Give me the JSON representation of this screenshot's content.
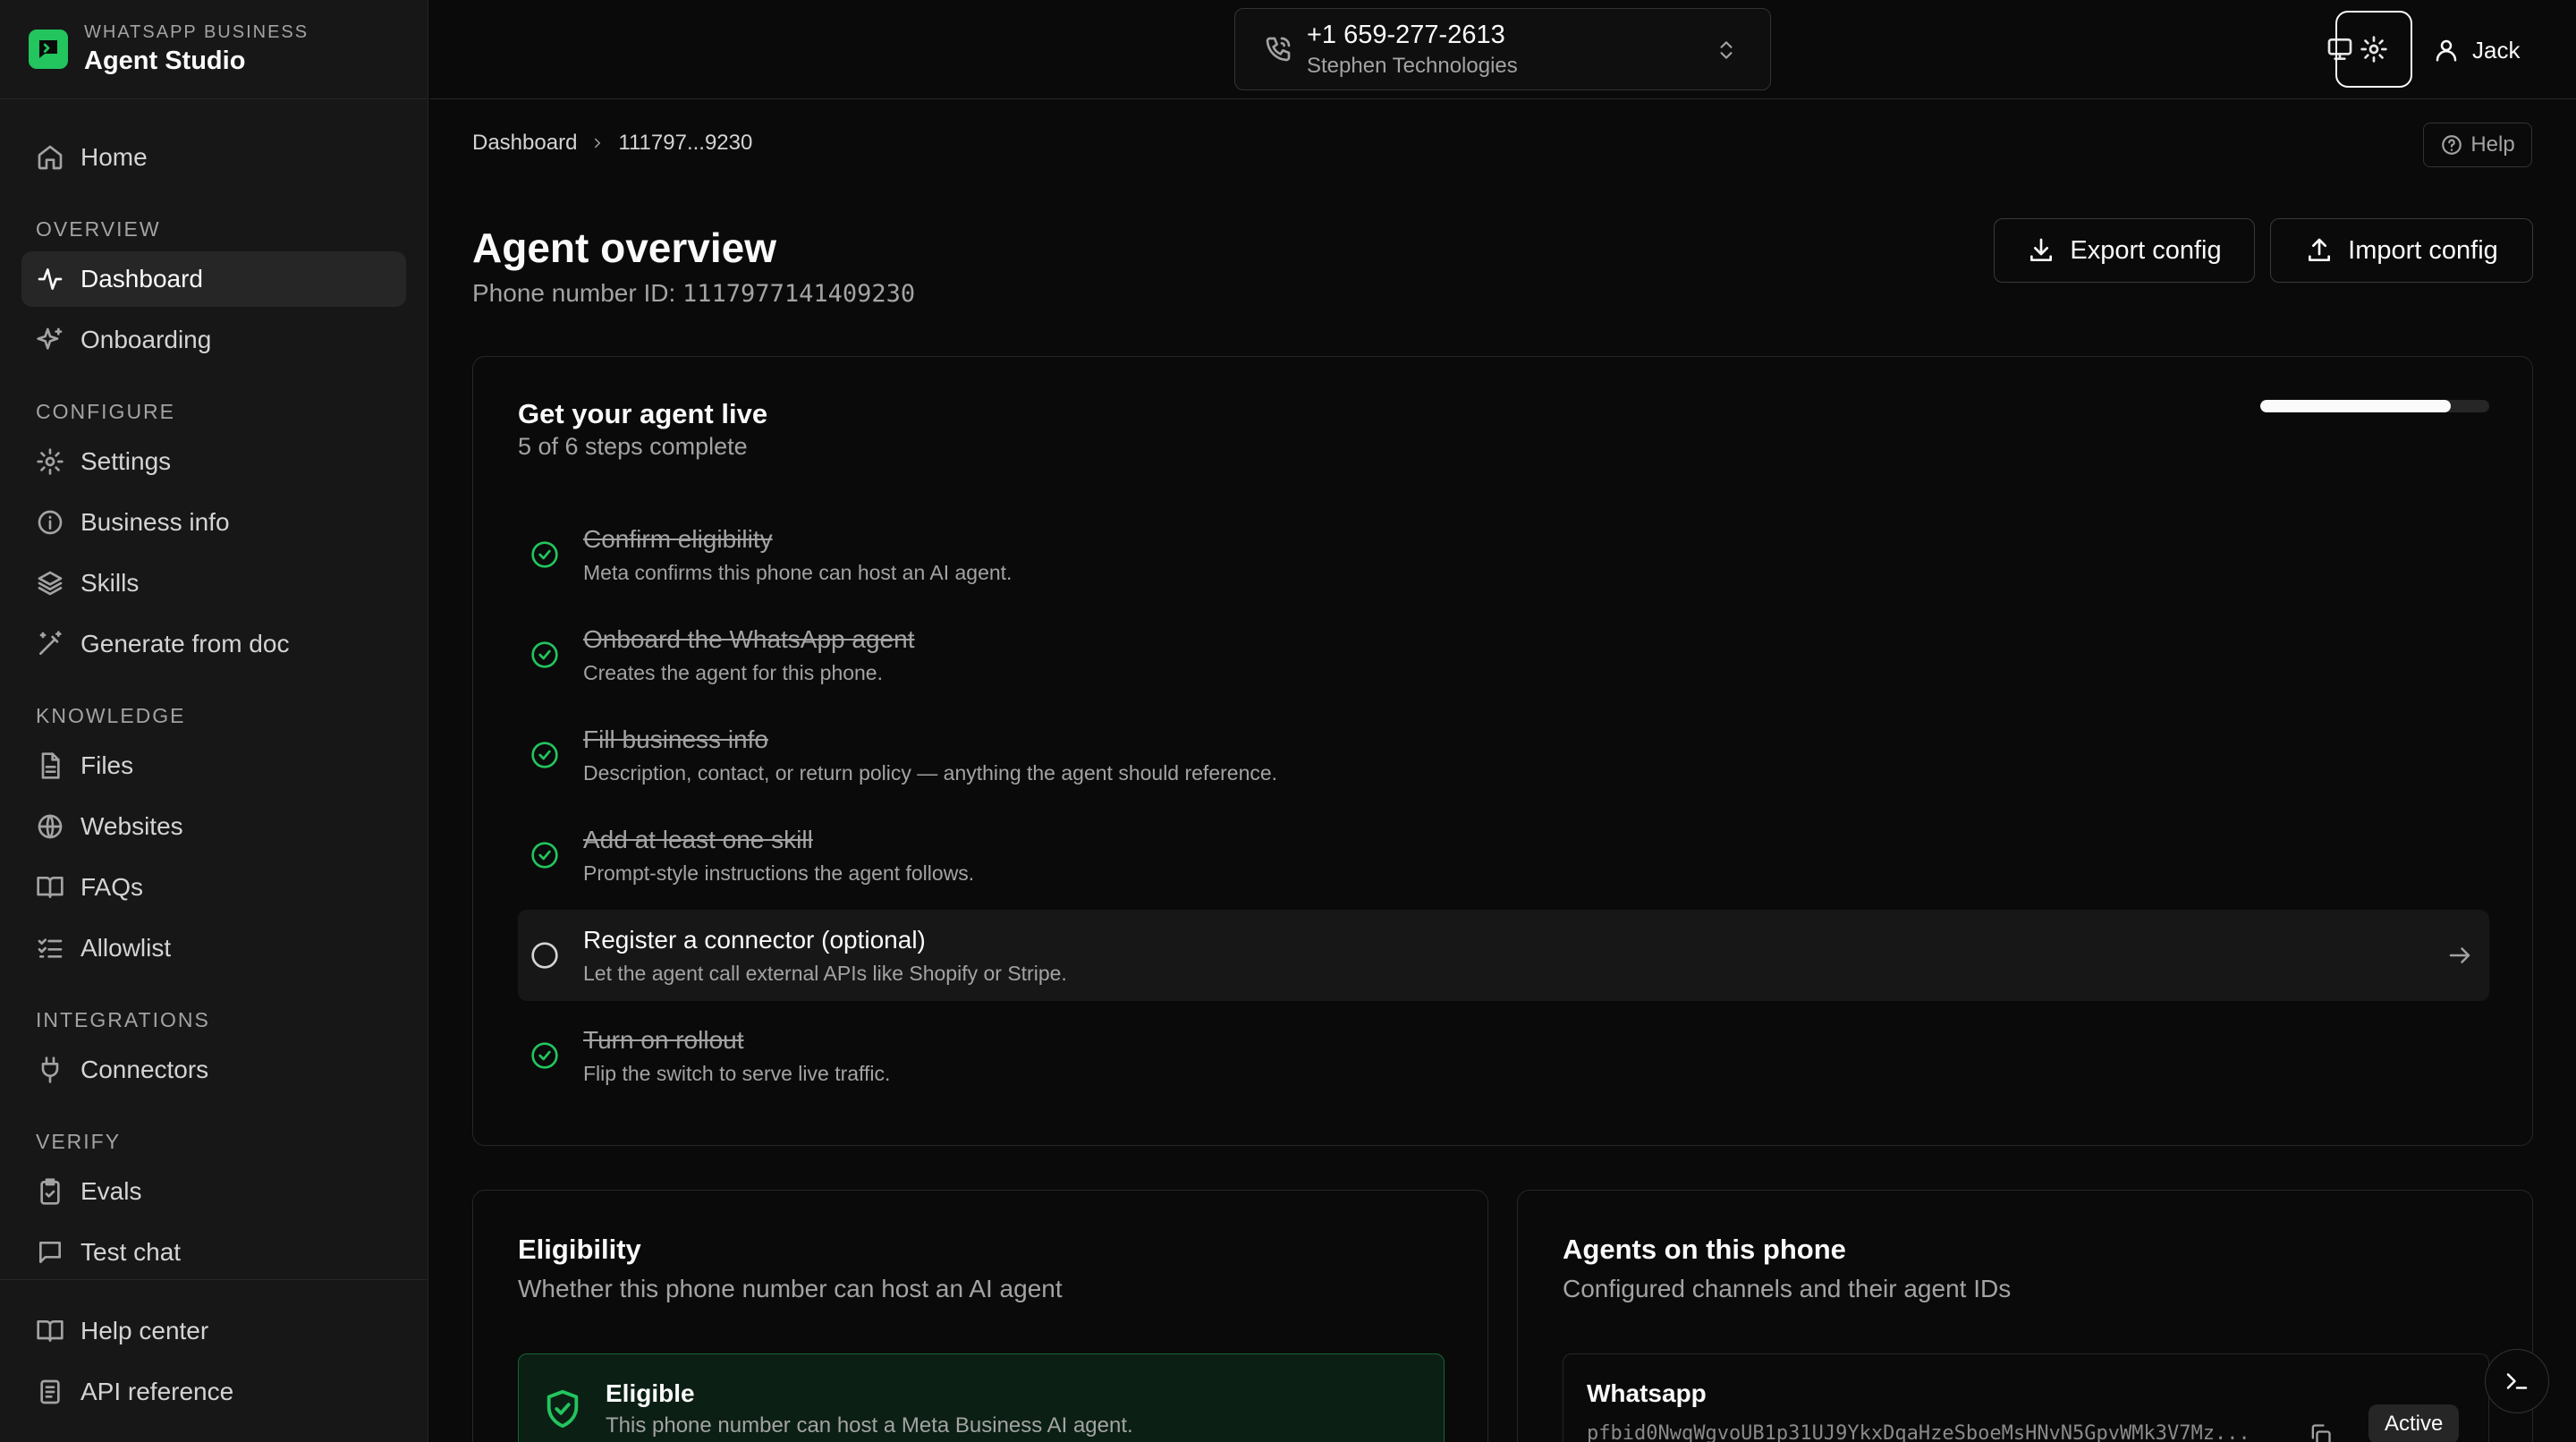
{
  "brand": {
    "subtitle": "WHATSAPP BUSINESS",
    "title": "Agent Studio"
  },
  "sidebar": {
    "home": "Home",
    "sections": {
      "overview": "OVERVIEW",
      "configure": "CONFIGURE",
      "knowledge": "KNOWLEDGE",
      "integrations": "INTEGRATIONS",
      "verify": "VERIFY"
    },
    "items": {
      "dashboard": "Dashboard",
      "onboarding": "Onboarding",
      "settings": "Settings",
      "business_info": "Business info",
      "skills": "Skills",
      "generate_from_doc": "Generate from doc",
      "files": "Files",
      "websites": "Websites",
      "faqs": "FAQs",
      "allowlist": "Allowlist",
      "connectors": "Connectors",
      "evals": "Evals",
      "test_chat": "Test chat",
      "help_center": "Help center",
      "api_reference": "API reference"
    },
    "active": "dashboard"
  },
  "topbar": {
    "phone_number": "+1 659-277-2613",
    "company": "Stephen Technologies",
    "user": "Jack"
  },
  "breadcrumb": {
    "root": "Dashboard",
    "current": "111797...9230"
  },
  "help_label": "Help",
  "page": {
    "title": "Agent overview",
    "phone_id_label": "Phone number ID:",
    "phone_id": "1117977141409230",
    "export_label": "Export config",
    "import_label": "Import config"
  },
  "steps_card": {
    "title": "Get your agent live",
    "subtitle": "5 of 6 steps complete",
    "progress": 0.833,
    "steps": [
      {
        "title": "Confirm eligibility",
        "desc": "Meta confirms this phone can host an AI agent.",
        "done": true
      },
      {
        "title": "Onboard the WhatsApp agent",
        "desc": "Creates the agent for this phone.",
        "done": true
      },
      {
        "title": "Fill business info",
        "desc": "Description, contact, or return policy — anything the agent should reference.",
        "done": true
      },
      {
        "title": "Add at least one skill",
        "desc": "Prompt-style instructions the agent follows.",
        "done": true
      },
      {
        "title": "Register a connector (optional)",
        "desc": "Let the agent call external APIs like Shopify or Stripe.",
        "done": false
      },
      {
        "title": "Turn on rollout",
        "desc": "Flip the switch to serve live traffic.",
        "done": true
      }
    ]
  },
  "eligibility": {
    "title": "Eligibility",
    "subtitle": "Whether this phone number can host an AI agent",
    "status": "Eligible",
    "desc": "This phone number can host a Meta Business AI agent."
  },
  "agents": {
    "title": "Agents on this phone",
    "subtitle": "Configured channels and their agent IDs",
    "channel": "Whatsapp",
    "agent_id": "pfbid0NwqWgvoUB1p31UJ9YkxDqaHzeSboeMsHNvN5GpvWMk3V7Mz...",
    "badge": "Active"
  },
  "colors": {
    "accent": "#22c55e",
    "background": "#0a0a0a",
    "sidebar": "#171717",
    "border": "#262626"
  }
}
